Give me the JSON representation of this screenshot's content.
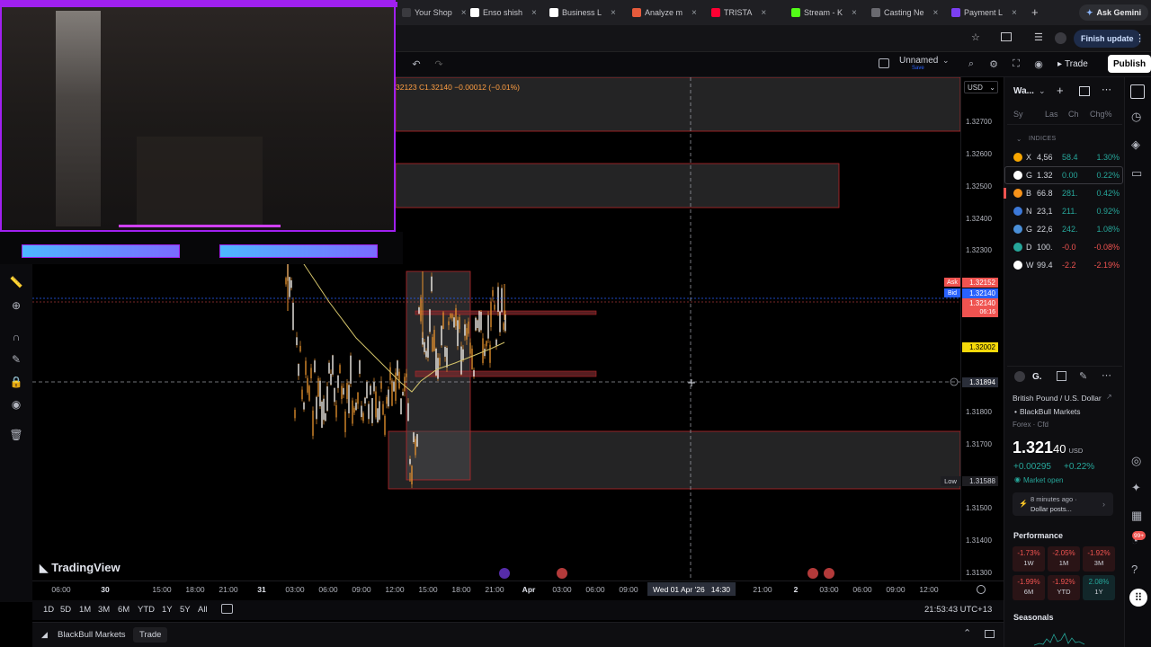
{
  "browser": {
    "tabs": [
      {
        "label": "Your Shop",
        "color": "#3a3a3f"
      },
      {
        "label": "Enso shish",
        "color": "#ffffff"
      },
      {
        "label": "Business L",
        "color": "#ffffff"
      },
      {
        "label": "Analyze m",
        "color": "#e65b3c"
      },
      {
        "label": "TRISTA",
        "color": "#ff0033"
      },
      {
        "label": "Stream - K",
        "color": "#53fc18"
      },
      {
        "label": "Casting Ne",
        "color": "#6a6a70"
      },
      {
        "label": "Payment L",
        "color": "#7b3ff2"
      }
    ],
    "new_tab": "+",
    "ask_gemini": "Ask Gemini",
    "finish_update": "Finish update"
  },
  "toolbar": {
    "layout_name": "Unnamed",
    "layout_status": "Save",
    "trade_label": "Trade",
    "publish_label": "Publish"
  },
  "legend": {
    "ohlc_text": "32123 C1.32140 −0.00012 (−0.01%)"
  },
  "price_axis": {
    "currency": "USD",
    "ticks": [
      "1.32700",
      "1.32600",
      "1.32500",
      "1.32400",
      "1.32300",
      "1.31800",
      "1.31700",
      "1.31500",
      "1.31400",
      "1.31300"
    ],
    "ask_label": "Ask",
    "ask_price": "1.32152",
    "bid_label": "Bid",
    "bid_price": "1.32140",
    "last_price": "1.32140",
    "countdown": "06:16",
    "yellow_price": "1.32002",
    "crosshair_price": "1.31894",
    "low_label": "Low",
    "low_price": "1.31588"
  },
  "time_axis": {
    "ticks": [
      "06:00",
      "30",
      "15:00",
      "18:00",
      "21:00",
      "31",
      "03:00",
      "06:00",
      "09:00",
      "12:00",
      "15:00",
      "18:00",
      "21:00",
      "Apr",
      "03:00",
      "06:00",
      "09:00",
      "21:00",
      "2",
      "03:00",
      "06:00",
      "09:00",
      "12:00"
    ],
    "crosshair_label": "Wed 01 Apr '26   14:30"
  },
  "range_bar": {
    "ranges": [
      "1D",
      "5D",
      "1M",
      "3M",
      "6M",
      "YTD",
      "1Y",
      "5Y",
      "All"
    ],
    "clock": "21:53:43 UTC+13"
  },
  "status_bar": {
    "broker": "BlackBull Markets",
    "trade": "Trade"
  },
  "watermark": "TradingView",
  "watchlist": {
    "title": "Wa...",
    "columns": [
      "Sy",
      "Las",
      "Ch",
      "Chg%"
    ],
    "section": "INDICES",
    "rows": [
      {
        "sym": "X",
        "last": "4,56",
        "chg": "58.4",
        "chgp": "1.30%",
        "dir": "pos",
        "color": "#f7a600"
      },
      {
        "sym": "G",
        "last": "1.32",
        "chg": "0.00",
        "chgp": "0.22%",
        "dir": "pos",
        "color": "#ffffff"
      },
      {
        "sym": "B",
        "last": "66.8",
        "chg": "281.",
        "chgp": "0.42%",
        "dir": "pos",
        "color": "#f7931a"
      },
      {
        "sym": "N",
        "last": "23,1",
        "chg": "211.",
        "chgp": "0.92%",
        "dir": "pos",
        "color": "#3c78d8"
      },
      {
        "sym": "G",
        "last": "22,6",
        "chg": "242.",
        "chgp": "1.08%",
        "dir": "pos",
        "color": "#4a8fd8"
      },
      {
        "sym": "D",
        "last": "100.",
        "chg": "-0.0",
        "chgp": "-0.08%",
        "dir": "neg",
        "color": "#26a69a"
      },
      {
        "sym": "W",
        "last": "99.4",
        "chg": "-2.2",
        "chgp": "-2.19%",
        "dir": "neg",
        "color": "#ffffff"
      }
    ]
  },
  "details": {
    "symbol_short": "G.",
    "name": "British Pound / U.S. Dollar",
    "broker": "BlackBull Markets",
    "type": "Forex · Cfd",
    "price_main": "1.321",
    "price_tail": "40",
    "currency": "USD",
    "change": "+0.00295",
    "change_pct": "+0.22%",
    "market_status": "Market open",
    "news_time": "8 minutes ago ·",
    "news_text": "Dollar posts...",
    "performance_title": "Performance",
    "performance": [
      {
        "value": "-1.73%",
        "period": "1W",
        "dir": "neg"
      },
      {
        "value": "-2.05%",
        "period": "1M",
        "dir": "neg"
      },
      {
        "value": "-1.92%",
        "period": "3M",
        "dir": "neg"
      },
      {
        "value": "-1.99%",
        "period": "6M",
        "dir": "neg"
      },
      {
        "value": "-1.92%",
        "period": "YTD",
        "dir": "neg"
      },
      {
        "value": "2.08%",
        "period": "1Y",
        "dir": "pos"
      }
    ],
    "seasonals_title": "Seasonals",
    "notif_badge": "99+"
  },
  "colors": {
    "up": "#26a69a",
    "down": "#ef5350",
    "candle": "#e8922e",
    "ma": "#d4c46a",
    "zone_border": "#b8262a",
    "zone_fill": "#2a2a2c",
    "overlay_accent": "#a020f0"
  }
}
